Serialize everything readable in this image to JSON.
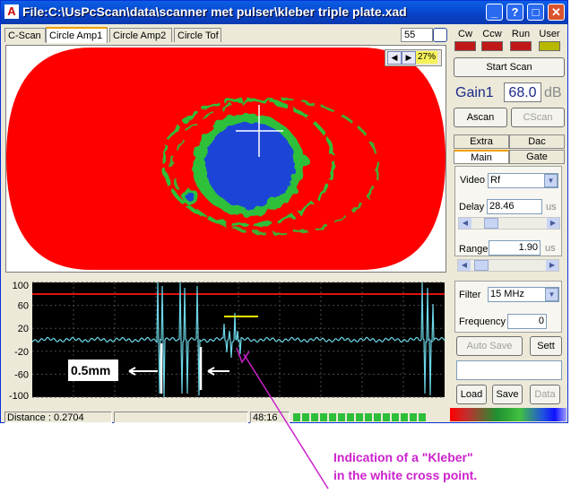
{
  "window": {
    "title": "File:C:\\UsPcScan\\data\\scanner met pulser\\kleber triple plate.xad",
    "app_icon": "A"
  },
  "tabs": [
    {
      "label": "C-Scan",
      "active": false
    },
    {
      "label": "Circle Amp1",
      "active": true
    },
    {
      "label": "Circle Amp2",
      "active": false
    },
    {
      "label": "Circle Tof",
      "active": false
    }
  ],
  "counter_value": "55",
  "cscan": {
    "zoom_percent": "27%",
    "colors": {
      "background": "#ff0000",
      "mid": "#2fc03a",
      "low": "#1c44d8",
      "cross": "#ffffff"
    }
  },
  "ascan": {
    "y_ticks": [
      "100",
      "60",
      "20",
      "-20",
      "-60",
      "-100"
    ],
    "measure_label": "0.5mm",
    "colors": {
      "signal": "#6cd6e6",
      "gate": "#e01010",
      "marker": "#f0f000",
      "grid": "#4a4a4a"
    }
  },
  "status_bar": {
    "distance": "Distance : 0.2704",
    "time": "48:16",
    "progress_segments": 15
  },
  "panel": {
    "indicators": [
      {
        "label": "Cw",
        "color": "#c01818"
      },
      {
        "label": "Ccw",
        "color": "#c01818"
      },
      {
        "label": "Run",
        "color": "#c01818"
      },
      {
        "label": "User",
        "color": "#b8b800"
      }
    ],
    "start_scan": "Start Scan",
    "gain_label": "Gain1",
    "gain_value": "68.0",
    "gain_unit": "dB",
    "ascan_button": "Ascan",
    "cscan_button": "CScan",
    "tabs_row1": [
      "Extra",
      "Dac"
    ],
    "tabs_row2": [
      "Main",
      "Gate"
    ],
    "video_label": "Video",
    "video_value": "Rf",
    "delay_label": "Delay",
    "delay_value": "28.46",
    "delay_unit": "us",
    "range_label": "Range",
    "range_value": "1.90",
    "range_unit": "us",
    "filter_label": "Filter",
    "filter_value": "15 MHz",
    "frequency_label": "Frequency",
    "frequency_value": "0",
    "auto_save": "Auto Save",
    "sett": "Sett",
    "load": "Load",
    "save": "Save",
    "data": "Data"
  },
  "annotation": {
    "line1": "Indication of a \"Kleber\"",
    "line2": "in the white cross point."
  }
}
